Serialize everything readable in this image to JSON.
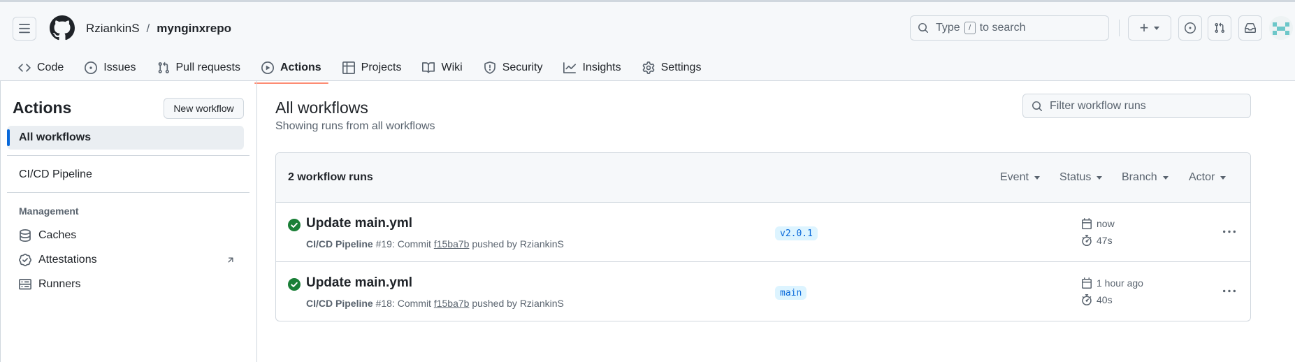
{
  "header": {
    "owner": "RziankinS",
    "separator": "/",
    "repo": "mynginxrepo",
    "search_prefix": "Type",
    "search_key": "/",
    "search_suffix": "to search",
    "plus_label": "+"
  },
  "tabs": [
    {
      "label": "Code",
      "icon": "code-icon"
    },
    {
      "label": "Issues",
      "icon": "issue-icon"
    },
    {
      "label": "Pull requests",
      "icon": "pull-request-icon"
    },
    {
      "label": "Actions",
      "icon": "play-icon",
      "active": true
    },
    {
      "label": "Projects",
      "icon": "table-icon"
    },
    {
      "label": "Wiki",
      "icon": "book-icon"
    },
    {
      "label": "Security",
      "icon": "shield-icon"
    },
    {
      "label": "Insights",
      "icon": "graph-icon"
    },
    {
      "label": "Settings",
      "icon": "gear-icon"
    }
  ],
  "sidebar": {
    "title": "Actions",
    "new_workflow": "New workflow",
    "all_workflows": "All workflows",
    "workflows": [
      "CI/CD Pipeline"
    ],
    "group_title": "Management",
    "management": [
      {
        "label": "Caches",
        "icon": "database-icon"
      },
      {
        "label": "Attestations",
        "icon": "verified-icon"
      },
      {
        "label": "Runners",
        "icon": "server-icon"
      }
    ]
  },
  "main": {
    "title": "All workflows",
    "subtitle": "Showing runs from all workflows",
    "filter_placeholder": "Filter workflow runs",
    "runs_count": "2 workflow runs",
    "filters": [
      "Event",
      "Status",
      "Branch",
      "Actor"
    ],
    "runs": [
      {
        "title": "Update main.yml",
        "workflow": "CI/CD Pipeline",
        "number": "#19",
        "commit_text": ": Commit",
        "sha": "f15ba7b",
        "pushed_by": "pushed by RziankinS",
        "branch": "v2.0.1",
        "when": "now",
        "duration": "47s",
        "status": "success"
      },
      {
        "title": "Update main.yml",
        "workflow": "CI/CD Pipeline",
        "number": "#18",
        "commit_text": ": Commit",
        "sha": "f15ba7b",
        "pushed_by": "pushed by RziankinS",
        "branch": "main",
        "when": "1 hour ago",
        "duration": "40s",
        "status": "success"
      }
    ]
  },
  "colors": {
    "accent": "#0969da",
    "success": "#1a7f37",
    "tab_underline": "#fd8c73",
    "branch_bg": "#ddf4ff"
  }
}
